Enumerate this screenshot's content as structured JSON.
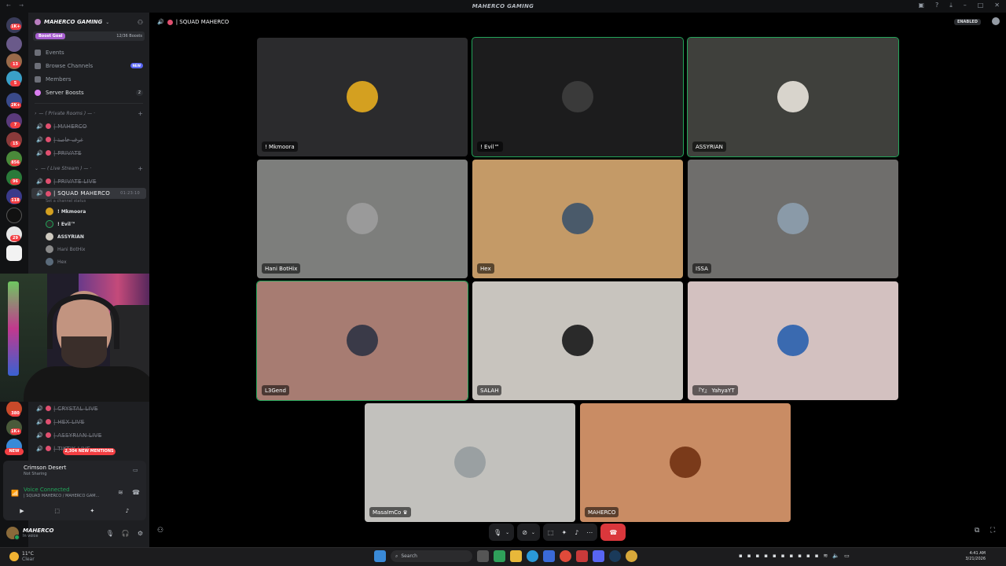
{
  "window": {
    "title": "MAHERCO GAMING"
  },
  "server": {
    "name": "MAHERCO GAMING",
    "boost_goal": "Boost Goal",
    "boost_count": "12/36 Boosts",
    "nav": {
      "events": "Events",
      "browse": "Browse Channels",
      "browse_badge": "NEW",
      "members": "Members",
      "boosts": "Server Boosts",
      "boosts_count": "2"
    }
  },
  "guild_badges": [
    "1K+",
    "",
    "13",
    "5",
    "2K+",
    "7",
    "15",
    "856",
    "96",
    "118",
    "",
    "29",
    "",
    "",
    "380",
    "1K+",
    "",
    "6"
  ],
  "categories": {
    "private": "— ( Private Rooms ) — ·",
    "live": "— ( Live Stream ) — ·"
  },
  "channels_private": [
    "| MAHERCO",
    "| غرف خاصة",
    "| PRIVATE"
  ],
  "channels_live": [
    "| PRIVATE LIVE"
  ],
  "active_channel": {
    "name": "| SQUAD MAHERCO",
    "time": "01:23:10",
    "status": "Set a channel status"
  },
  "voice_users": [
    "! Mkmoora",
    "! Evil™",
    "ASSYRIAN",
    "Hani BotHix",
    "Hex"
  ],
  "channels_after": [
    "| CRYSTAL LIVE",
    "| HEX LIVE",
    "| ASSYRIAN LIVE",
    "| TIKTIK LIVE"
  ],
  "mentions": "2,304 NEW MENTIONS",
  "new_pill": "NEW",
  "activity": {
    "game": "Crimson Desert",
    "sub": "Not Sharing"
  },
  "voice": {
    "status": "Voice Connected",
    "channel": "| SQUAD MAHERCO / MAHERCO GAM..."
  },
  "user": {
    "name": "MAHERCO",
    "status": "In voice"
  },
  "call": {
    "channel_title": "| SQUAD MAHERCO",
    "enabled": "ENABLED",
    "tiles": [
      {
        "name": "! Mkmoora",
        "bg": "#2b2b2d",
        "av": "#d4a020",
        "speaking": false
      },
      {
        "name": "! Evil™",
        "bg": "#1c1c1d",
        "av": "#3a3a3a",
        "speaking": true
      },
      {
        "name": "ASSYRIAN",
        "bg": "#3f403c",
        "av": "#d8d4cc",
        "speaking": true
      },
      {
        "name": "Hani BotHix",
        "bg": "#7d7e7c",
        "av": "#9a9a9a",
        "speaking": false
      },
      {
        "name": "Hex",
        "bg": "#c49a67",
        "av": "#4a5a6a",
        "speaking": false
      },
      {
        "name": "ISSA",
        "bg": "#6f6e6c",
        "av": "#8a9aa8",
        "speaking": false
      },
      {
        "name": "L3Gend",
        "bg": "#a77c72",
        "av": "#3a3a48",
        "speaking": true
      },
      {
        "name": "SALAH",
        "bg": "#c8c4be",
        "av": "#2a2a2a",
        "speaking": false
      },
      {
        "name": "『Y』 YahyaYT",
        "bg": "#d3c1c0",
        "av": "#3a6ab0",
        "speaking": false
      },
      {
        "name": "MasaImCo ♛",
        "bg": "#c2c1bd",
        "av": "#9aa0a2",
        "speaking": false
      },
      {
        "name": "MAHERCO",
        "bg": "#c98c64",
        "av": "#7a3a1a",
        "speaking": false
      }
    ]
  },
  "taskbar": {
    "temp": "11°C",
    "weather": "Clear",
    "search": "Search",
    "time": "4:41 AM",
    "date": "3/21/2026"
  }
}
